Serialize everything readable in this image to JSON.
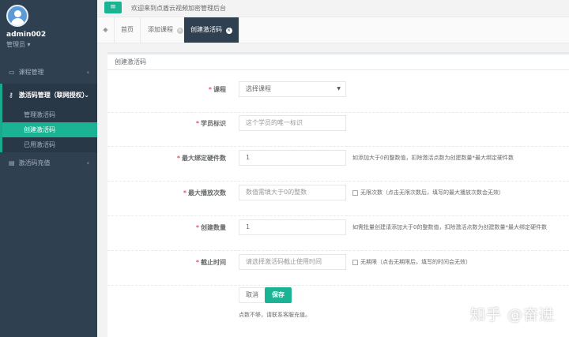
{
  "colors": {
    "sidebar": "#2f4050",
    "accent": "#1ab394",
    "required": "#ed5565"
  },
  "profile": {
    "username": "admin002",
    "role": "管理员 ▾"
  },
  "sidebar": {
    "items": [
      {
        "label": "课程管理",
        "icon": "monitor-icon",
        "chevron": "‹"
      },
      {
        "label": "激活码管理（联网授权）",
        "icon": "key-icon",
        "chevron": "⌄"
      },
      {
        "label": "激活码充值",
        "icon": "credit-card-icon",
        "chevron": "‹"
      }
    ],
    "sub_items": [
      "管理激活码",
      "创建激活码",
      "已用激活码"
    ]
  },
  "topbar": {
    "menu_icon": "≡",
    "welcome": "欢迎来到点盾云视频加密管理后台"
  },
  "tabs": [
    {
      "label": "首页"
    },
    {
      "label": "添加课程"
    },
    {
      "label": "创建激活码"
    }
  ],
  "form": {
    "title": "创建激活码",
    "course": {
      "label": "课程",
      "value": "选择课程"
    },
    "student_id": {
      "label": "学员标识",
      "placeholder": "这个学员的唯一标识"
    },
    "max_bind": {
      "label": "最大绑定硬件数",
      "value": "1",
      "help": "如添加大于0的整数值，扣除激活点数为创建数量*最大绑定硬件数"
    },
    "max_play": {
      "label": "最大播放次数",
      "placeholder": "数值需填大于0的整数",
      "help": "无限次数（点击无限次数后，填写的最大播放次数会无效）"
    },
    "create_count": {
      "label": "创建数量",
      "value": "1",
      "help": "如需批量创建请添加大于0的整数值，扣除激活点数为创建数量*最大绑定硬件数"
    },
    "deadline": {
      "label": "截止时间",
      "placeholder": "请选择激活码截止使用时间",
      "help": "无期限（点击无期限后，填写的时间会无效）"
    },
    "cancel_label": "取消",
    "save_label": "保存",
    "note": "点数不够，请联系客服充值。"
  },
  "watermark": "知乎 @奋进"
}
